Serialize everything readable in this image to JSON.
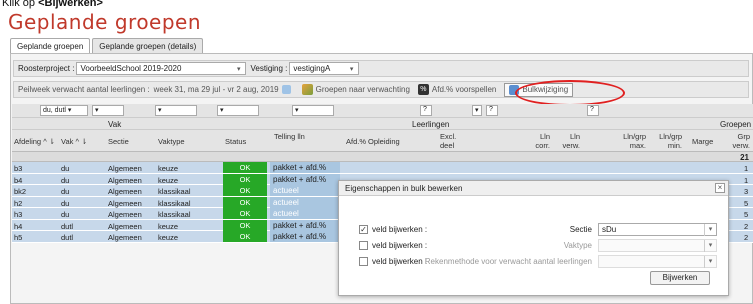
{
  "instruction": {
    "prefix": "Klik op ",
    "bold": "<Bijwerken>"
  },
  "page_title": "Geplande groepen",
  "tabs": [
    "Geplande groepen",
    "Geplande groepen (details)"
  ],
  "filters": {
    "roosterproject_label": "Roosterproject :",
    "roosterproject_value": "VoorbeeldSchool 2019-2020",
    "vestiging_label": "Vestiging :",
    "vestiging_value": "vestigingA"
  },
  "peil": {
    "label": "Peilweek verwacht aantal leerlingen :",
    "value": "week 31, ma 29 jul - vr 2 aug, 2019",
    "groepen_btn": "Groepen naar verwachting",
    "afd_btn": "Afd.% voorspellen",
    "bulk_btn": "Bulkwijziging"
  },
  "grid": {
    "filter_vak": "du, dutl",
    "group_vak": "Vak",
    "group_leerlingen": "Leerlingen",
    "group_groepen": "Groepen",
    "filter_q1": "?",
    "filter_q2": "?",
    "filter_q3": "?",
    "columns": {
      "afdeling": "Afdeling",
      "vak": "Vak",
      "sectie": "Sectie",
      "vaktype": "Vaktype",
      "status": "Status",
      "telling": "Telling lln",
      "afd": "Afd.%",
      "opleiding": "Opleiding",
      "excl": "Excl. deel",
      "llncorr": "Lln corr.",
      "llnverw": "Lln verw.",
      "llngrpmax": "Lln/grp max.",
      "llngrpmin": "Lln/grp min.",
      "marge": "Marge",
      "grpverw": "Grp verw."
    },
    "sum": "21",
    "rows": [
      {
        "afd": "b3",
        "vak": "du",
        "sectie": "Algemeen",
        "vaktype": "keuze",
        "status": "OK",
        "telling": "pakket + afd.%",
        "muted": false,
        "grp": "1"
      },
      {
        "afd": "b4",
        "vak": "du",
        "sectie": "Algemeen",
        "vaktype": "keuze",
        "status": "OK",
        "telling": "pakket + afd.%",
        "muted": false,
        "grp": "1"
      },
      {
        "afd": "bk2",
        "vak": "du",
        "sectie": "Algemeen",
        "vaktype": "klassikaal",
        "status": "OK",
        "telling": "actueel",
        "muted": true,
        "grp": "3"
      },
      {
        "afd": "h2",
        "vak": "du",
        "sectie": "Algemeen",
        "vaktype": "klassikaal",
        "status": "OK",
        "telling": "actueel",
        "muted": true,
        "grp": "5"
      },
      {
        "afd": "h3",
        "vak": "du",
        "sectie": "Algemeen",
        "vaktype": "klassikaal",
        "status": "OK",
        "telling": "actueel",
        "muted": true,
        "grp": "5"
      },
      {
        "afd": "h4",
        "vak": "dutl",
        "sectie": "Algemeen",
        "vaktype": "keuze",
        "status": "OK",
        "telling": "pakket + afd.%",
        "muted": false,
        "grp": "2"
      },
      {
        "afd": "h5",
        "vak": "dutl",
        "sectie": "Algemeen",
        "vaktype": "keuze",
        "status": "OK",
        "telling": "pakket + afd.%",
        "muted": false,
        "grp": "2"
      }
    ]
  },
  "dialog": {
    "title": "Eigenschappen in bulk bewerken",
    "close": "×",
    "row1": {
      "check": "✓",
      "label": "veld bijwerken :",
      "field": "Sectie",
      "value": "sDu"
    },
    "row2": {
      "label": "veld bijwerken :",
      "field": "Vaktype",
      "value": ""
    },
    "row3": {
      "label": "veld bijwerken :",
      "field": "Rekenmethode voor verwacht aantal leerlingen",
      "value": ""
    },
    "button": "Bijwerken"
  }
}
